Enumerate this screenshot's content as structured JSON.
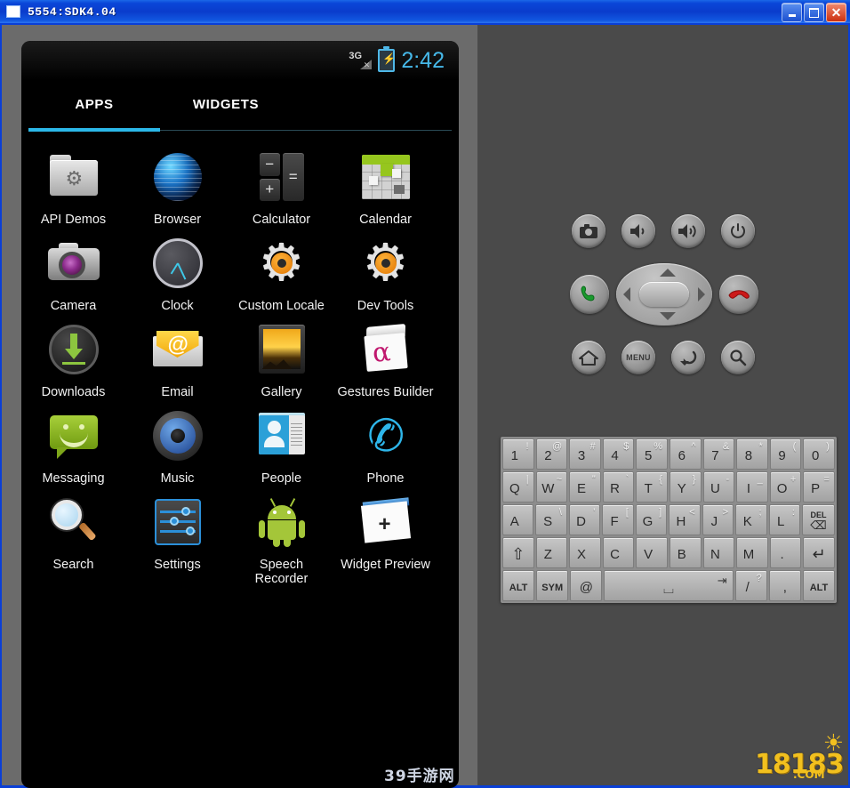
{
  "window": {
    "title": "5554:SDK4.04",
    "icon": "window-icon",
    "controls": {
      "minimize": "minimize-button",
      "maximize": "maximize-button",
      "close_label": "✕"
    }
  },
  "statusbar": {
    "network": "3G",
    "battery_icon": "battery-charging-icon",
    "bolt": "⚡",
    "signal_x": "✕",
    "time": "2:42"
  },
  "tabs": [
    {
      "label": "APPS",
      "active": true
    },
    {
      "label": "WIDGETS",
      "active": false
    }
  ],
  "apps": [
    [
      {
        "label": "API Demos",
        "icon": "api-demos-icon"
      },
      {
        "label": "Browser",
        "icon": "browser-icon"
      },
      {
        "label": "Calculator",
        "icon": "calculator-icon",
        "keys": [
          "−",
          "=",
          "+"
        ]
      },
      {
        "label": "Calendar",
        "icon": "calendar-icon"
      }
    ],
    [
      {
        "label": "Camera",
        "icon": "camera-icon"
      },
      {
        "label": "Clock",
        "icon": "clock-icon"
      },
      {
        "label": "Custom Locale",
        "icon": "custom-locale-icon"
      },
      {
        "label": "Dev Tools",
        "icon": "dev-tools-icon"
      }
    ],
    [
      {
        "label": "Downloads",
        "icon": "downloads-icon"
      },
      {
        "label": "Email",
        "icon": "email-icon",
        "at": "@"
      },
      {
        "label": "Gallery",
        "icon": "gallery-icon"
      },
      {
        "label": "Gestures Builder",
        "icon": "gestures-builder-icon",
        "glyph": "α"
      }
    ],
    [
      {
        "label": "Messaging",
        "icon": "messaging-icon"
      },
      {
        "label": "Music",
        "icon": "music-icon"
      },
      {
        "label": "People",
        "icon": "people-icon"
      },
      {
        "label": "Phone",
        "icon": "phone-icon",
        "glyph": "✆"
      }
    ],
    [
      {
        "label": "Search",
        "icon": "search-icon"
      },
      {
        "label": "Settings",
        "icon": "settings-icon"
      },
      {
        "label": "Speech Recorder",
        "icon": "speech-recorder-icon"
      },
      {
        "label": "Widget Preview",
        "icon": "widget-preview-icon",
        "plus": "+"
      }
    ]
  ],
  "hardware": {
    "camera": {
      "name": "camera-button",
      "glyph": "■"
    },
    "volume_down": {
      "name": "volume-down-button",
      "glyph": "🔈"
    },
    "volume_up": {
      "name": "volume-up-button",
      "glyph": "🔊"
    },
    "power": {
      "name": "power-button",
      "glyph": "⏻"
    },
    "call": {
      "name": "call-button",
      "glyph": "✆"
    },
    "end_call": {
      "name": "end-call-button",
      "glyph": "✆"
    },
    "home": {
      "name": "home-button",
      "glyph": "⌂"
    },
    "menu": {
      "name": "menu-button",
      "label": "MENU"
    },
    "back": {
      "name": "back-button",
      "glyph": "↩"
    },
    "search": {
      "name": "search-button",
      "glyph": "⌕"
    },
    "dpad": {
      "name": "dpad",
      "up": "▲",
      "down": "▼",
      "left": "◀",
      "right": "▶"
    }
  },
  "keyboard": {
    "rows": [
      [
        {
          "main": "1",
          "sup": "!"
        },
        {
          "main": "2",
          "sup": "@"
        },
        {
          "main": "3",
          "sup": "#"
        },
        {
          "main": "4",
          "sup": "$"
        },
        {
          "main": "5",
          "sup": "%"
        },
        {
          "main": "6",
          "sup": "^"
        },
        {
          "main": "7",
          "sup": "&"
        },
        {
          "main": "8",
          "sup": "*"
        },
        {
          "main": "9",
          "sup": "("
        },
        {
          "main": "0",
          "sup": ")"
        }
      ],
      [
        {
          "main": "Q",
          "sup": "|"
        },
        {
          "main": "W",
          "sup": "~"
        },
        {
          "main": "E",
          "sup": "\""
        },
        {
          "main": "R",
          "sup": "`"
        },
        {
          "main": "T",
          "sup": "{"
        },
        {
          "main": "Y",
          "sup": "}"
        },
        {
          "main": "U",
          "sup": "-"
        },
        {
          "main": "I",
          "sup": "_"
        },
        {
          "main": "O",
          "sup": "+"
        },
        {
          "main": "P",
          "sup": "="
        }
      ],
      [
        {
          "main": "A",
          "sup": ""
        },
        {
          "main": "S",
          "sup": "\\"
        },
        {
          "main": "D",
          "sup": "'"
        },
        {
          "main": "F",
          "sup": "["
        },
        {
          "main": "G",
          "sup": "]"
        },
        {
          "main": "H",
          "sup": "<"
        },
        {
          "main": "J",
          "sup": ">"
        },
        {
          "main": "K",
          "sup": ";"
        },
        {
          "main": "L",
          "sup": ":"
        },
        {
          "main": "DEL",
          "sup": "",
          "type": "del",
          "del_top": "DEL",
          "del_bot": "⌫"
        }
      ],
      [
        {
          "main": "⇧",
          "sup": "",
          "type": "shift"
        },
        {
          "main": "Z",
          "sup": ""
        },
        {
          "main": "X",
          "sup": ""
        },
        {
          "main": "C",
          "sup": ""
        },
        {
          "main": "V",
          "sup": ""
        },
        {
          "main": "B",
          "sup": ""
        },
        {
          "main": "N",
          "sup": ""
        },
        {
          "main": "M",
          "sup": ""
        },
        {
          "main": ".",
          "sup": ""
        },
        {
          "main": "↵",
          "sup": "",
          "type": "enter"
        }
      ],
      [
        {
          "main": "ALT",
          "sup": "",
          "type": "label"
        },
        {
          "main": "SYM",
          "sup": "",
          "type": "label"
        },
        {
          "main": "@",
          "sup": ""
        },
        {
          "main": "⌴",
          "sup": "",
          "type": "space",
          "tab": "⇥"
        },
        {
          "main": "/",
          "sup": "?"
        },
        {
          "main": ",",
          "sup": ""
        },
        {
          "main": "ALT",
          "sup": "",
          "type": "label"
        }
      ]
    ]
  },
  "watermarks": {
    "bottom_center": "39手游网",
    "logo_text": "18183",
    "logo_suffix": ".COM",
    "logo_sun": "☀"
  },
  "colors": {
    "titlebar": "#0a3ccc",
    "accent_cyan": "#2bb8e8",
    "panel_left": "#6b6b6b",
    "panel_right": "#4a4a4a",
    "screen_bg": "#000000",
    "clock_blue": "#46b8e8",
    "logo_gold": "#f2c01e"
  }
}
